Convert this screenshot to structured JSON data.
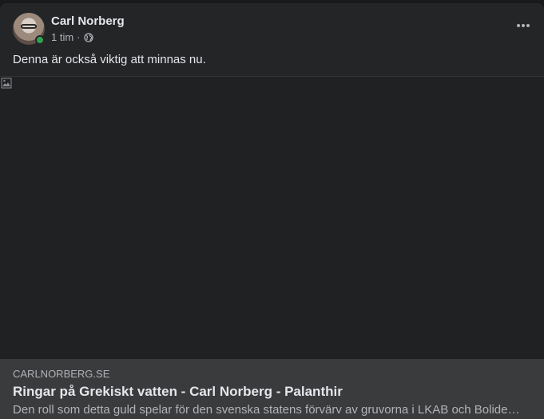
{
  "post": {
    "author": "Carl Norberg",
    "time": "1 tim",
    "separator": "·",
    "privacy_icon": "globe-icon",
    "text": "Denna är också viktig att minnas nu."
  },
  "link_preview": {
    "image_icon": "broken-image-icon",
    "domain": "CARLNORBERG.SE",
    "title": "Ringar på Grekiskt vatten - Carl Norberg - Palanthir",
    "description": "Den roll som detta guld spelar för den svenska statens förvärv av gruvorna i LKAB och Bolide…"
  },
  "colors": {
    "background": "#18191a",
    "card": "#242526",
    "link_bar": "#3a3b3c",
    "online": "#31a24c",
    "primary_text": "#e4e6eb",
    "secondary_text": "#b0b3b8"
  }
}
